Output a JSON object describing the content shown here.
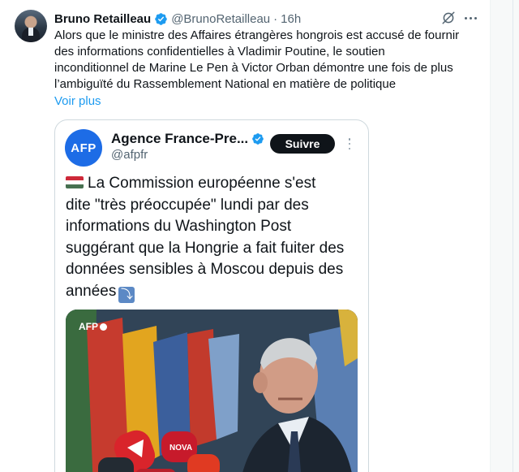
{
  "tweet": {
    "author_name": "Bruno Retailleau",
    "handle": "@BrunoRetailleau",
    "separator": "·",
    "time": "16h",
    "text_lines": [
      "Alors que le ministre des Affaires étrangères hongrois est accusé de fournir",
      "des informations confidentielles à Vladimir Poutine, le soutien",
      "inconditionnel de Marine Le Pen à Victor Orban démontre une fois de plus",
      "l’ambiguïté du Rassemblement National en matière de politique"
    ],
    "show_more": "Voir plus"
  },
  "quoted": {
    "logo_text": "AFP",
    "name": "Agence France-Pre...",
    "handle": "@afpfr",
    "follow_label": "Suivre",
    "text_lines": [
      "La Commission européenne s'est",
      "dite \"très préoccupée\" lundi par des",
      "informations du Washington Post",
      "suggérant que la Hongrie a fait fuiter des",
      "données sensibles à Moscou depuis des",
      "années"
    ],
    "arrow_glyph": "⤵",
    "photo_watermark": "AFP",
    "photo_microphone_text": "NOVA"
  },
  "icons": {
    "verified": "verified-badge-icon",
    "grok": "grok-icon",
    "more": "more-icon",
    "flag": "hungary-flag-icon",
    "arrow": "arrow-down-icon"
  },
  "colors": {
    "accent": "#1d9bf0",
    "text_primary": "#0f1419",
    "text_secondary": "#536471",
    "afp_blue": "#1d6ce6",
    "follow_bg": "#0f1419"
  }
}
